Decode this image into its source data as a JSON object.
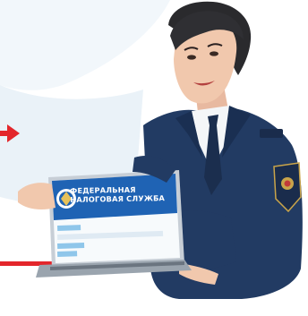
{
  "screen": {
    "title_line1": "ФЕДЕРАЛЬНАЯ",
    "title_line2": "НАЛОГОВАЯ СЛУЖБА",
    "header_color": "#1f63b4",
    "field_color": "#8fc6ea"
  },
  "accents": {
    "arrow_color": "#e3262b",
    "uniform_color": "#223b63",
    "background_tint": "#e8f1f7"
  },
  "icons": [
    "arrow-right-icon",
    "emblem-icon",
    "shoulder-patch-icon"
  ]
}
